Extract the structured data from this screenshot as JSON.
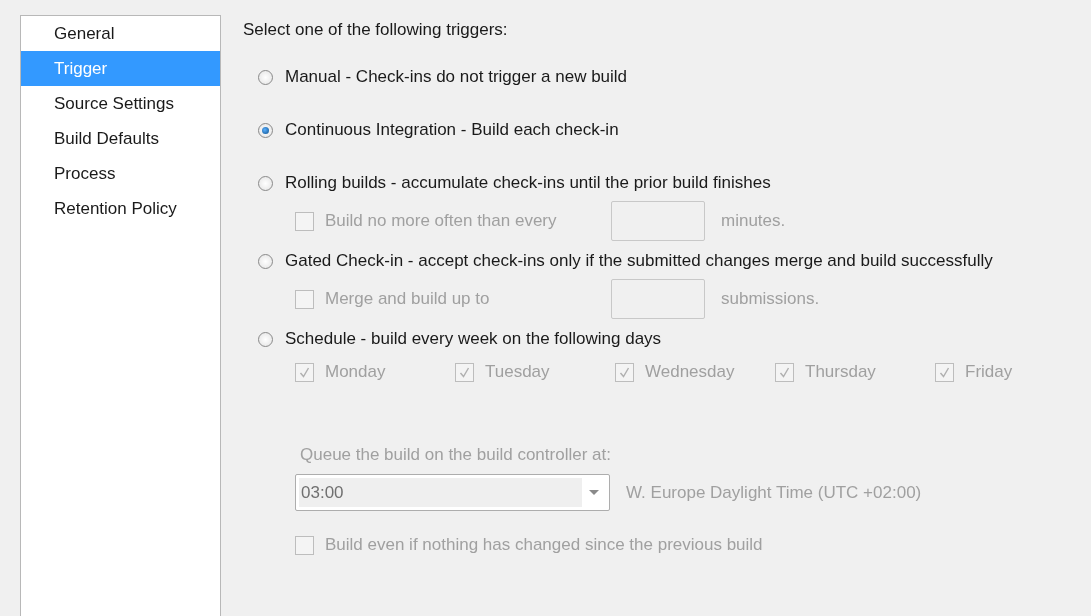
{
  "sidebar": {
    "items": [
      {
        "label": "General",
        "selected": false
      },
      {
        "label": "Trigger",
        "selected": true
      },
      {
        "label": "Source Settings",
        "selected": false
      },
      {
        "label": "Build Defaults",
        "selected": false
      },
      {
        "label": "Process",
        "selected": false
      },
      {
        "label": "Retention Policy",
        "selected": false
      }
    ]
  },
  "heading": "Select one of the following triggers:",
  "triggers": [
    {
      "kind": "plain",
      "label": "Manual - Check-ins do not trigger a new build",
      "selected": false
    },
    {
      "kind": "plain",
      "label": "Continuous Integration - Build each check-in",
      "selected": true
    },
    {
      "kind": "limit",
      "label": "Rolling builds - accumulate check-ins until the prior build finishes",
      "selected": false,
      "option": {
        "label": "Build no more often than every",
        "checked": false,
        "disabled": true,
        "suffix": "minutes."
      }
    },
    {
      "kind": "limit",
      "label": "Gated Check-in - accept check-ins only if the submitted changes merge and build successfully",
      "selected": false,
      "option": {
        "label": "Merge and build up to",
        "checked": false,
        "disabled": true,
        "suffix": "submissions."
      }
    },
    {
      "kind": "schedule",
      "label": "Schedule - build every week on the following days",
      "selected": false,
      "days": [
        {
          "label": "Monday",
          "checked": true,
          "disabled": true
        },
        {
          "label": "Tuesday",
          "checked": true,
          "disabled": true
        },
        {
          "label": "Wednesday",
          "checked": true,
          "disabled": true
        },
        {
          "label": "Thursday",
          "checked": true,
          "disabled": true
        },
        {
          "label": "Friday",
          "checked": true,
          "disabled": true
        }
      ],
      "queue_label": "Queue the build on the build controller at:",
      "time": {
        "value": "03:00",
        "disabled": true
      },
      "timezone": "W. Europe Daylight Time (UTC +02:00)",
      "force": {
        "label": "Build even if nothing has changed since the previous build",
        "checked": false,
        "disabled": true
      }
    }
  ]
}
